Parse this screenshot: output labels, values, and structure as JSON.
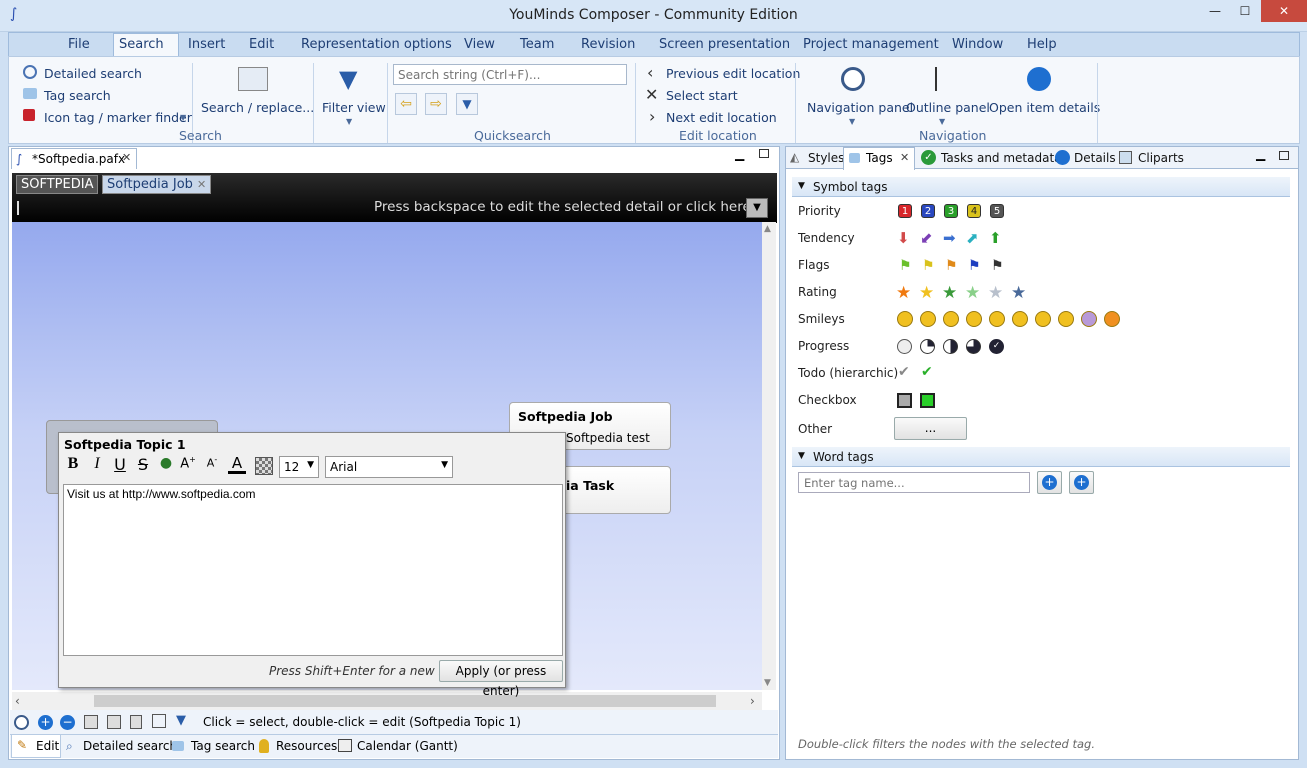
{
  "window": {
    "title": "YouMinds Composer - Community Edition",
    "minimize": "—",
    "maximize": "☐",
    "close": "✕"
  },
  "menu": [
    "File",
    "Search",
    "Insert",
    "Edit",
    "Representation options",
    "View",
    "Team",
    "Revision",
    "Screen presentation",
    "Project management",
    "Window",
    "Help"
  ],
  "ribbon": {
    "search_group": {
      "detailed_search": "Detailed search",
      "tag_search": "Tag search",
      "icon_tag_finder": "Icon tag / marker finder",
      "search_replace": "Search / replace...",
      "filter_view": "Filter view",
      "label": "Search"
    },
    "quicksearch": {
      "placeholder": "Search string (Ctrl+F)...",
      "label": "Quicksearch"
    },
    "edit_location": {
      "previous": "Previous edit location",
      "select_start": "Select start",
      "next": "Next edit location",
      "label": "Edit location"
    },
    "navigation": {
      "navigation_panel": "Navigation panel",
      "outline_panel": "Outline panel",
      "open_item_details": "Open item details",
      "label": "Navigation"
    }
  },
  "editor_tab": {
    "filename": "*Softpedia.pafx",
    "breadcrumbs": [
      "SOFTPEDIA",
      "Softpedia Job"
    ],
    "hint": "Press backspace to edit the selected detail or click here:"
  },
  "map": {
    "node_job_title": "Softpedia Job",
    "node_job_sub": "Softpedia test",
    "node_task": "ia Task"
  },
  "text_editor": {
    "title": "Softpedia Topic 1",
    "font_size": "12",
    "font_family": "Arial",
    "content": "Visit us at http://www.softpedia.com",
    "hint": "Press Shift+Enter for a new line",
    "apply": "Apply (or press enter)"
  },
  "status": {
    "text": "Click = select, double-click = edit (Softpedia Topic 1)"
  },
  "bottom_tabs": [
    "Edit",
    "Detailed search",
    "Tag search",
    "Resources",
    "Calendar (Gantt)"
  ],
  "right_panel": {
    "tabs": [
      "Styles",
      "Tags",
      "Tasks and metadata",
      "Details",
      "Cliparts"
    ],
    "symbol_tags_label": "Symbol tags",
    "rows": [
      "Priority",
      "Tendency",
      "Flags",
      "Rating",
      "Smileys",
      "Progress",
      "Todo (hierarchic)",
      "Checkbox",
      "Other"
    ],
    "priority": [
      "1",
      "2",
      "3",
      "4",
      "5"
    ],
    "priority_colors": [
      "#d8262a",
      "#2a48c0",
      "#2aa02a",
      "#d9c21c",
      "#555555"
    ],
    "other_button": "...",
    "word_tags_label": "Word tags",
    "tag_input_placeholder": "Enter tag name...",
    "footer": "Double-click filters the nodes with the selected tag."
  }
}
